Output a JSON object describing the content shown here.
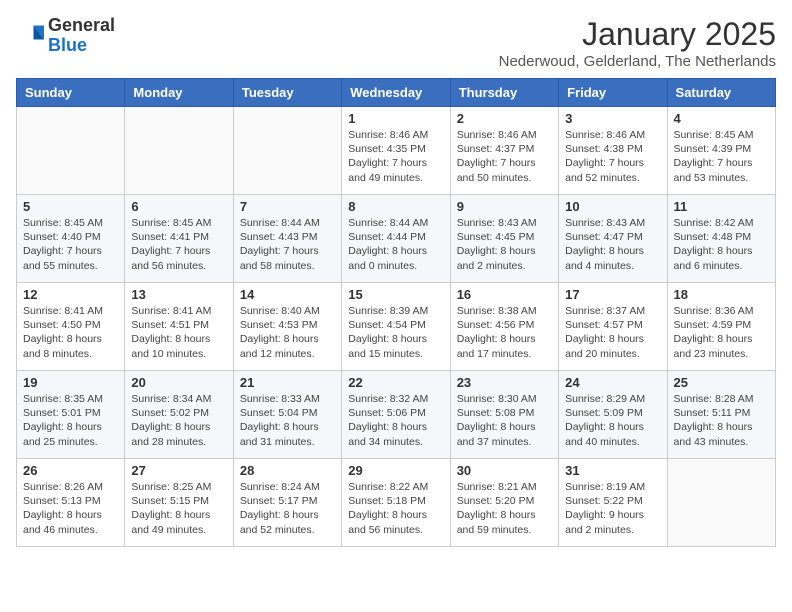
{
  "header": {
    "logo": {
      "general": "General",
      "blue": "Blue"
    },
    "title": "January 2025",
    "subtitle": "Nederwoud, Gelderland, The Netherlands"
  },
  "weekdays": [
    "Sunday",
    "Monday",
    "Tuesday",
    "Wednesday",
    "Thursday",
    "Friday",
    "Saturday"
  ],
  "weeks": [
    [
      {
        "day": "",
        "info": ""
      },
      {
        "day": "",
        "info": ""
      },
      {
        "day": "",
        "info": ""
      },
      {
        "day": "1",
        "info": "Sunrise: 8:46 AM\nSunset: 4:35 PM\nDaylight: 7 hours\nand 49 minutes."
      },
      {
        "day": "2",
        "info": "Sunrise: 8:46 AM\nSunset: 4:37 PM\nDaylight: 7 hours\nand 50 minutes."
      },
      {
        "day": "3",
        "info": "Sunrise: 8:46 AM\nSunset: 4:38 PM\nDaylight: 7 hours\nand 52 minutes."
      },
      {
        "day": "4",
        "info": "Sunrise: 8:45 AM\nSunset: 4:39 PM\nDaylight: 7 hours\nand 53 minutes."
      }
    ],
    [
      {
        "day": "5",
        "info": "Sunrise: 8:45 AM\nSunset: 4:40 PM\nDaylight: 7 hours\nand 55 minutes."
      },
      {
        "day": "6",
        "info": "Sunrise: 8:45 AM\nSunset: 4:41 PM\nDaylight: 7 hours\nand 56 minutes."
      },
      {
        "day": "7",
        "info": "Sunrise: 8:44 AM\nSunset: 4:43 PM\nDaylight: 7 hours\nand 58 minutes."
      },
      {
        "day": "8",
        "info": "Sunrise: 8:44 AM\nSunset: 4:44 PM\nDaylight: 8 hours\nand 0 minutes."
      },
      {
        "day": "9",
        "info": "Sunrise: 8:43 AM\nSunset: 4:45 PM\nDaylight: 8 hours\nand 2 minutes."
      },
      {
        "day": "10",
        "info": "Sunrise: 8:43 AM\nSunset: 4:47 PM\nDaylight: 8 hours\nand 4 minutes."
      },
      {
        "day": "11",
        "info": "Sunrise: 8:42 AM\nSunset: 4:48 PM\nDaylight: 8 hours\nand 6 minutes."
      }
    ],
    [
      {
        "day": "12",
        "info": "Sunrise: 8:41 AM\nSunset: 4:50 PM\nDaylight: 8 hours\nand 8 minutes."
      },
      {
        "day": "13",
        "info": "Sunrise: 8:41 AM\nSunset: 4:51 PM\nDaylight: 8 hours\nand 10 minutes."
      },
      {
        "day": "14",
        "info": "Sunrise: 8:40 AM\nSunset: 4:53 PM\nDaylight: 8 hours\nand 12 minutes."
      },
      {
        "day": "15",
        "info": "Sunrise: 8:39 AM\nSunset: 4:54 PM\nDaylight: 8 hours\nand 15 minutes."
      },
      {
        "day": "16",
        "info": "Sunrise: 8:38 AM\nSunset: 4:56 PM\nDaylight: 8 hours\nand 17 minutes."
      },
      {
        "day": "17",
        "info": "Sunrise: 8:37 AM\nSunset: 4:57 PM\nDaylight: 8 hours\nand 20 minutes."
      },
      {
        "day": "18",
        "info": "Sunrise: 8:36 AM\nSunset: 4:59 PM\nDaylight: 8 hours\nand 23 minutes."
      }
    ],
    [
      {
        "day": "19",
        "info": "Sunrise: 8:35 AM\nSunset: 5:01 PM\nDaylight: 8 hours\nand 25 minutes."
      },
      {
        "day": "20",
        "info": "Sunrise: 8:34 AM\nSunset: 5:02 PM\nDaylight: 8 hours\nand 28 minutes."
      },
      {
        "day": "21",
        "info": "Sunrise: 8:33 AM\nSunset: 5:04 PM\nDaylight: 8 hours\nand 31 minutes."
      },
      {
        "day": "22",
        "info": "Sunrise: 8:32 AM\nSunset: 5:06 PM\nDaylight: 8 hours\nand 34 minutes."
      },
      {
        "day": "23",
        "info": "Sunrise: 8:30 AM\nSunset: 5:08 PM\nDaylight: 8 hours\nand 37 minutes."
      },
      {
        "day": "24",
        "info": "Sunrise: 8:29 AM\nSunset: 5:09 PM\nDaylight: 8 hours\nand 40 minutes."
      },
      {
        "day": "25",
        "info": "Sunrise: 8:28 AM\nSunset: 5:11 PM\nDaylight: 8 hours\nand 43 minutes."
      }
    ],
    [
      {
        "day": "26",
        "info": "Sunrise: 8:26 AM\nSunset: 5:13 PM\nDaylight: 8 hours\nand 46 minutes."
      },
      {
        "day": "27",
        "info": "Sunrise: 8:25 AM\nSunset: 5:15 PM\nDaylight: 8 hours\nand 49 minutes."
      },
      {
        "day": "28",
        "info": "Sunrise: 8:24 AM\nSunset: 5:17 PM\nDaylight: 8 hours\nand 52 minutes."
      },
      {
        "day": "29",
        "info": "Sunrise: 8:22 AM\nSunset: 5:18 PM\nDaylight: 8 hours\nand 56 minutes."
      },
      {
        "day": "30",
        "info": "Sunrise: 8:21 AM\nSunset: 5:20 PM\nDaylight: 8 hours\nand 59 minutes."
      },
      {
        "day": "31",
        "info": "Sunrise: 8:19 AM\nSunset: 5:22 PM\nDaylight: 9 hours\nand 2 minutes."
      },
      {
        "day": "",
        "info": ""
      }
    ]
  ]
}
